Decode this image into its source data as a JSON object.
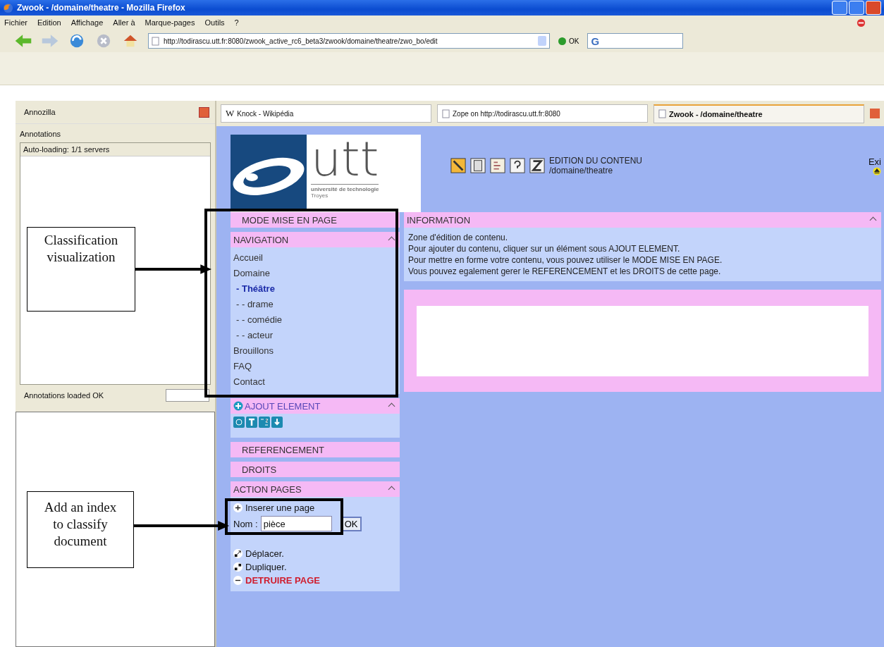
{
  "window": {
    "title": "Zwook - /domaine/theatre - Mozilla Firefox"
  },
  "menu": [
    "Fichier",
    "Edition",
    "Affichage",
    "Aller à",
    "Marque-pages",
    "Outils",
    "?"
  ],
  "address": {
    "url": "http://todirascu.utt.fr:8080/zwook_active_rc6_beta3/zwook/domaine/theatre/zwo_bo/edit",
    "go": "OK"
  },
  "sidebar": {
    "title": "Annozilla",
    "section": "Annotations",
    "list_header": "Auto-loading: 1/1 servers",
    "status": "Annotations loaded OK"
  },
  "search": {
    "icon_glyph": "G"
  },
  "tabs": [
    {
      "label": "Knock - Wikipédia",
      "icon_glyph": "W",
      "selected": false
    },
    {
      "label": "Zope on http://todirascu.utt.fr:8080",
      "selected": false
    },
    {
      "label": "Zwook - /domaine/theatre",
      "selected": true
    }
  ],
  "logo": {
    "name": "utt",
    "line1": "université de technologie",
    "line2": "Troyes"
  },
  "header": {
    "title": "EDITION DU CONTENU",
    "path": "/domaine/theatre",
    "exit": "Exi"
  },
  "mode_bar": "MODE MISE EN PAGE",
  "navigation": {
    "title": "NAVIGATION",
    "items": [
      {
        "label": "Accueil",
        "selected": false
      },
      {
        "label": "Domaine",
        "selected": false,
        "children": [
          {
            "label": "- Théâtre",
            "selected": true,
            "children": [
              {
                "label": "- - drame",
                "selected": false
              },
              {
                "label": "- - comédie",
                "selected": false
              },
              {
                "label": "- - acteur",
                "selected": false
              }
            ]
          }
        ]
      },
      {
        "label": "Brouillons",
        "selected": false
      },
      {
        "label": "FAQ",
        "selected": false
      },
      {
        "label": "Contact",
        "selected": false
      }
    ]
  },
  "add_element": {
    "title": "AJOUT ELEMENT"
  },
  "bars": [
    "REFERENCEMENT",
    "DROITS"
  ],
  "action_pages": {
    "title": "ACTION PAGES",
    "items": [
      {
        "kind": "insert",
        "label": "Inserer une page"
      },
      {
        "kind": "name",
        "label": "Nom :",
        "value": "pièce",
        "button": "OK"
      },
      {
        "kind": "covered"
      },
      {
        "kind": "move",
        "label": "Déplacer."
      },
      {
        "kind": "duplicate",
        "label": "Dupliquer."
      },
      {
        "kind": "destroy",
        "label": "DETRUIRE PAGE"
      }
    ]
  },
  "information": {
    "title": "INFORMATION",
    "lines": [
      "Zone d'édition de contenu.",
      "Pour ajouter du contenu, cliquer sur un élément sous AJOUT ELEMENT.",
      "Pour mettre en forme votre contenu, vous pouvez utiliser le MODE MISE EN PAGE.",
      "Vous pouvez egalement gerer le REFERENCEMENT et les DROITS de cette page."
    ]
  },
  "annotations": [
    {
      "text": "Classification visualization"
    },
    {
      "text": "Add an index to classify document"
    }
  ]
}
